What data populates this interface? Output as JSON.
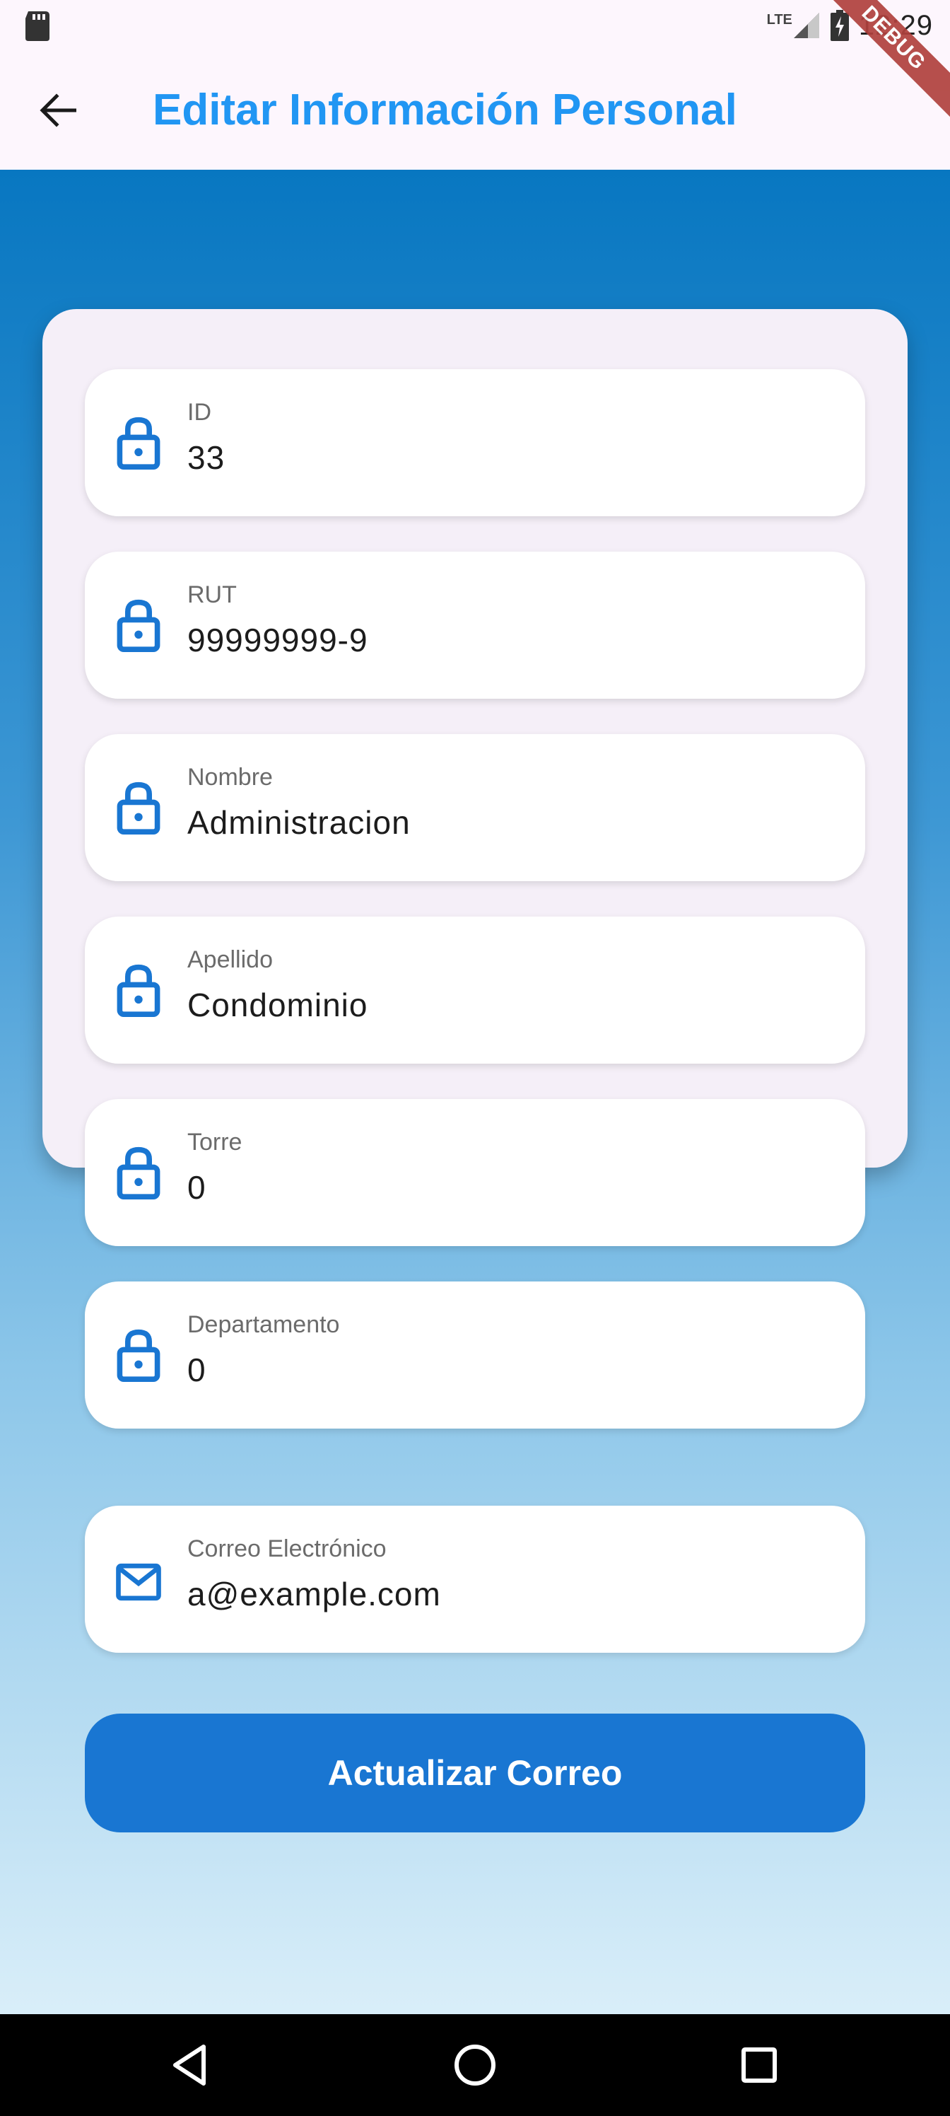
{
  "status_bar": {
    "time": "12:29",
    "network": "LTE",
    "icons": [
      "sd-card-icon",
      "signal-icon",
      "battery-charging-icon"
    ]
  },
  "debug_banner": "DEBUG",
  "app_bar": {
    "title": "Editar Información Personal",
    "back_icon": "arrow-back-icon"
  },
  "form": {
    "fields": [
      {
        "label": "ID",
        "value": "33",
        "icon": "lock-icon"
      },
      {
        "label": "RUT",
        "value": "99999999-9",
        "icon": "lock-icon"
      },
      {
        "label": "Nombre",
        "value": "Administracion",
        "icon": "lock-icon"
      },
      {
        "label": "Apellido",
        "value": "Condominio",
        "icon": "lock-icon"
      },
      {
        "label": "Torre",
        "value": "0",
        "icon": "lock-icon"
      },
      {
        "label": "Departamento",
        "value": "0",
        "icon": "lock-icon"
      }
    ],
    "email": {
      "label": "Correo Electrónico",
      "value": "a@example.com",
      "icon": "mail-icon"
    },
    "submit_label": "Actualizar Correo"
  },
  "colors": {
    "accent": "#2196f3",
    "button": "#1976d2",
    "icon": "#1976d2",
    "card": "#f5eff8"
  },
  "nav_bar": {
    "items": [
      "back-triangle-icon",
      "home-circle-icon",
      "recents-square-icon"
    ]
  }
}
